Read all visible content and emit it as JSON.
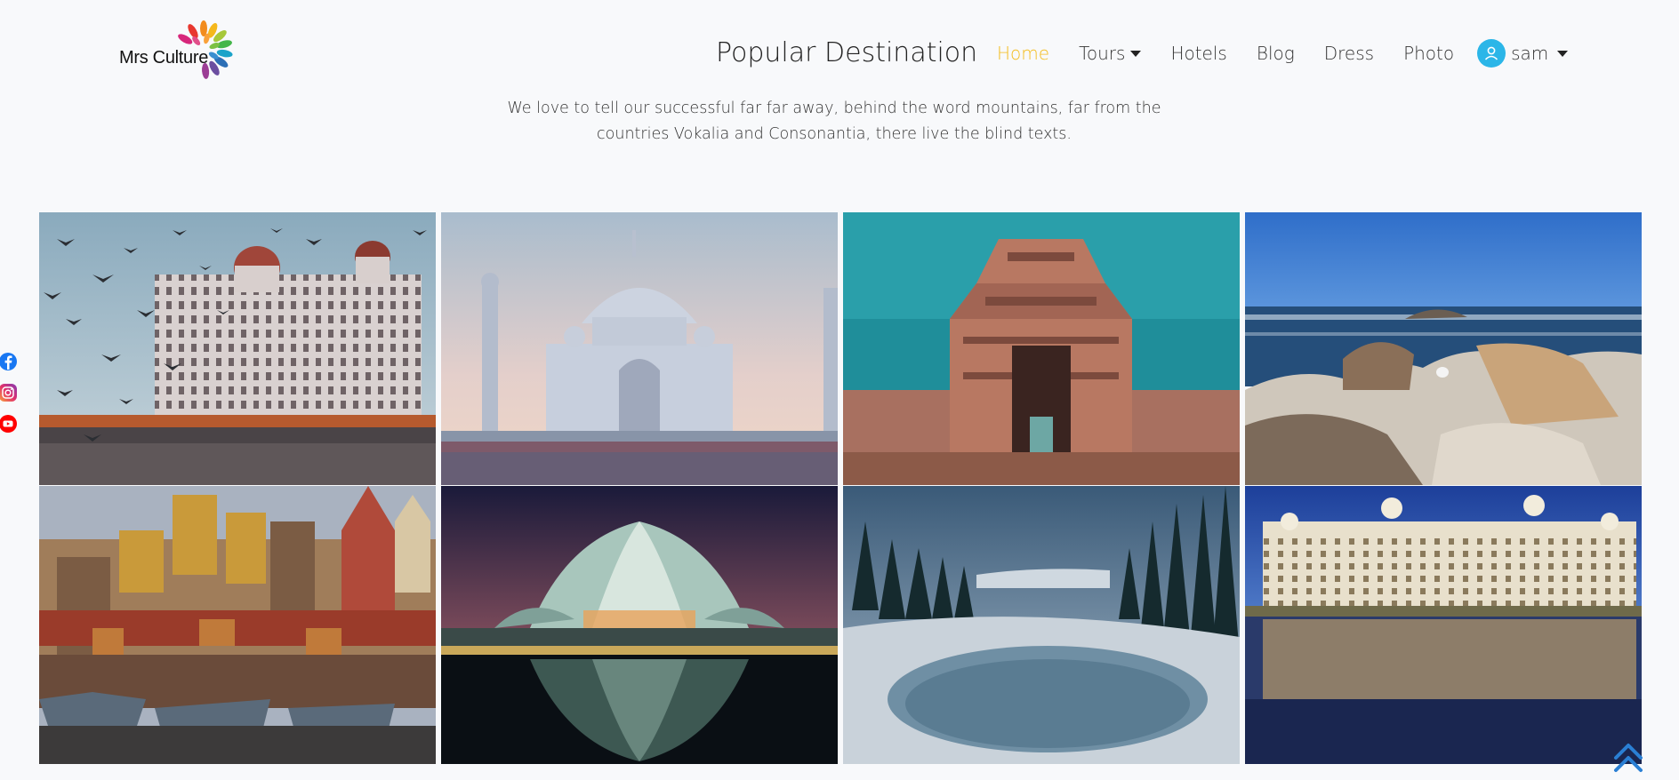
{
  "brand": {
    "name": "Mrs Culture"
  },
  "page_title": "Popular Destination",
  "nav": {
    "items": [
      {
        "label": "Home",
        "active": true
      },
      {
        "label": "Tours",
        "dropdown": true
      },
      {
        "label": "Hotels"
      },
      {
        "label": "Blog"
      },
      {
        "label": "Dress"
      },
      {
        "label": "Photo"
      }
    ],
    "user": {
      "name": "sam",
      "icon": "user-avatar-icon"
    }
  },
  "subtitle": {
    "line1": "We love to tell our successful far far away, behind the word mountains, far from the",
    "line2": "countries Vokalia and Consonantia, there live the blind texts."
  },
  "social": [
    "facebook-icon",
    "instagram-icon",
    "youtube-icon"
  ],
  "gallery": [
    {
      "name": "photo-palace-hotel-birds"
    },
    {
      "name": "photo-white-domed-mausoleum"
    },
    {
      "name": "photo-stone-temple-gopuram"
    },
    {
      "name": "photo-rocky-seashore"
    },
    {
      "name": "photo-riverside-ghats"
    },
    {
      "name": "photo-lotus-shaped-temple-night"
    },
    {
      "name": "photo-snowy-forest-lake"
    },
    {
      "name": "photo-lakeside-palace"
    }
  ],
  "colors": {
    "accent": "#f3bc1c",
    "avatar": "#2bb6e8",
    "scroll_top": "#2a7fd4"
  }
}
